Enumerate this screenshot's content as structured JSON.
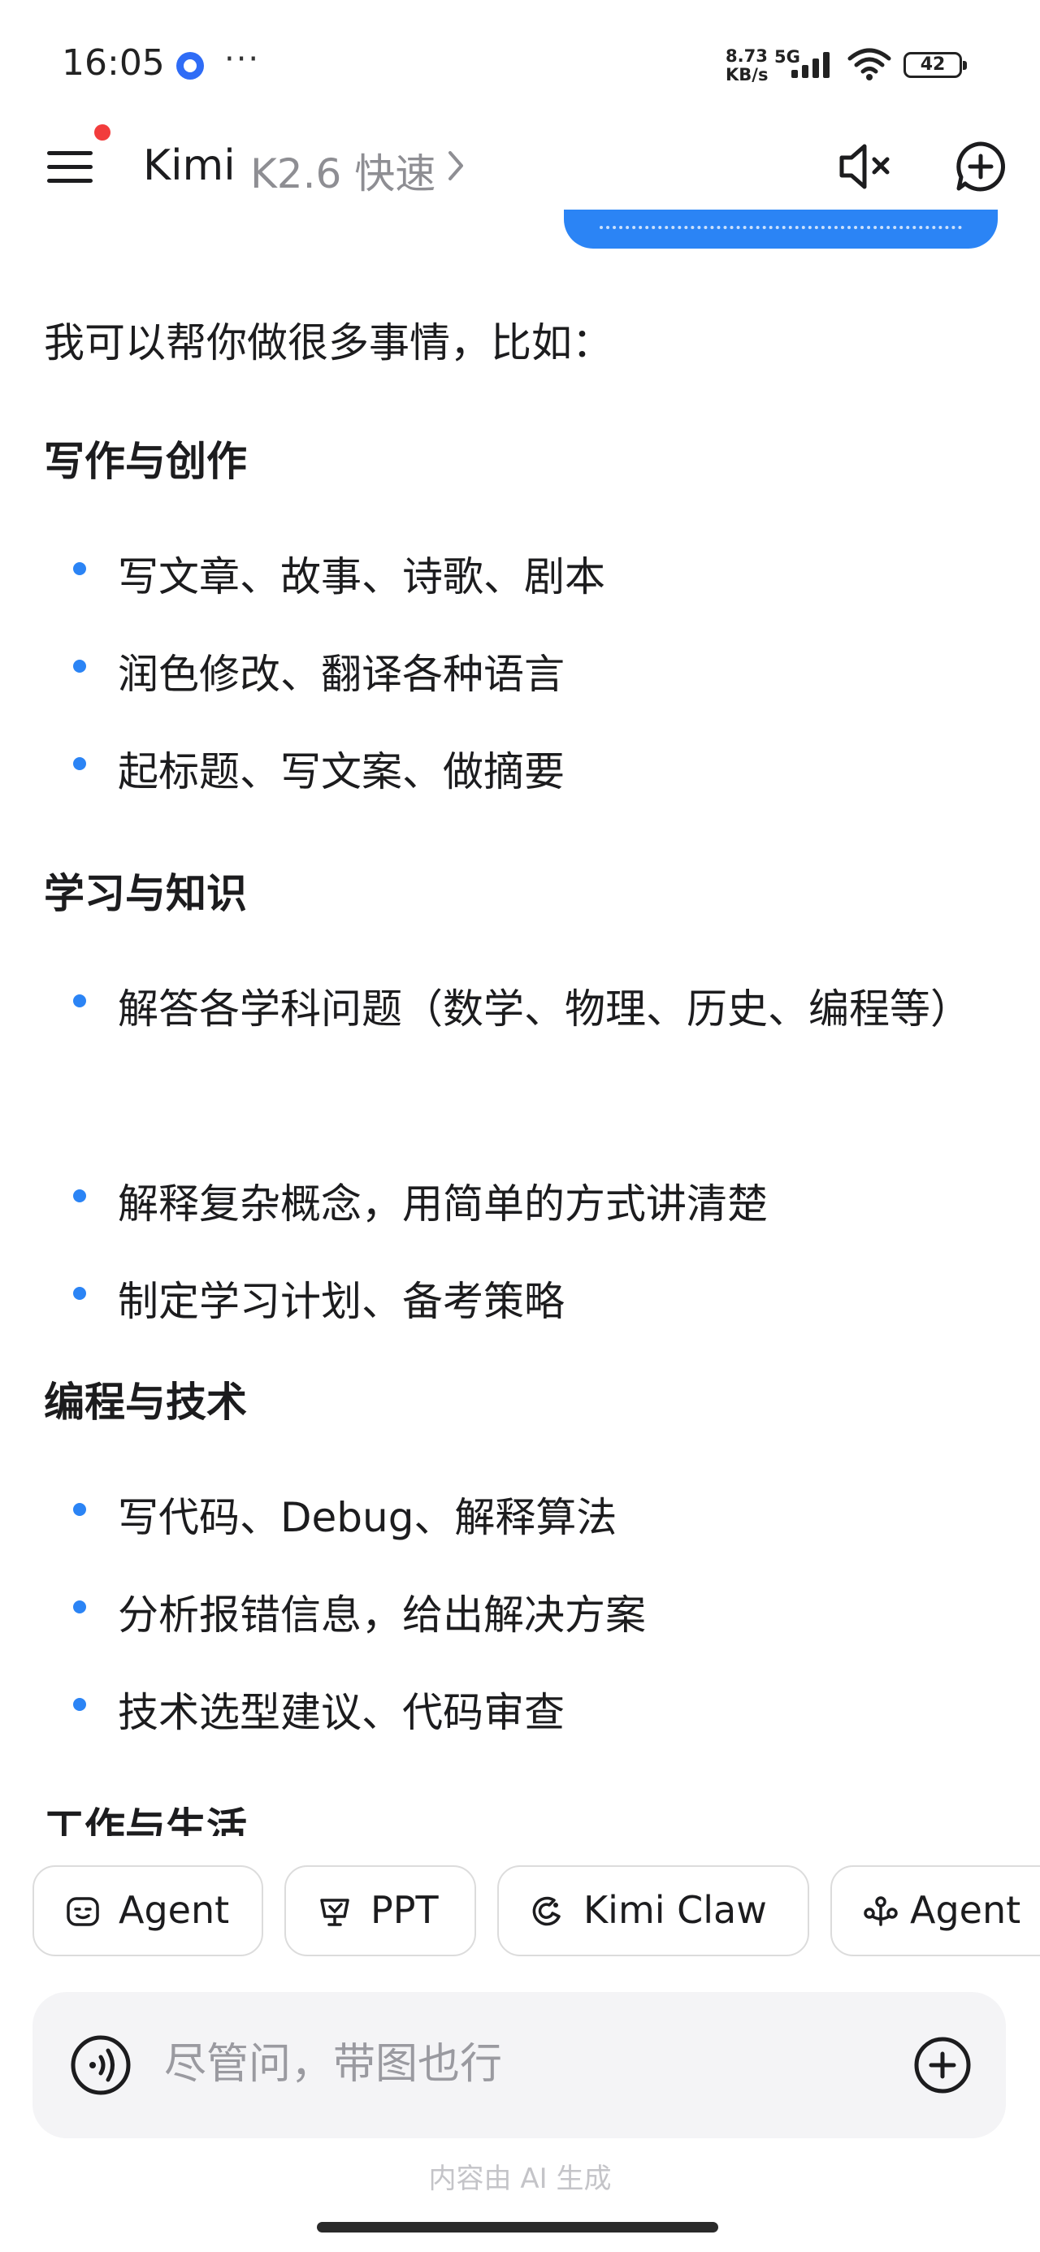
{
  "status_bar": {
    "time": "16:05",
    "net_speed_value": "8.73",
    "net_speed_unit": "KB/s",
    "network_type": "5G",
    "battery": "42"
  },
  "header": {
    "title": "Kimi",
    "model": "K2.6 快速"
  },
  "message": {
    "intro": "我可以帮你做很多事情，比如：",
    "sections": [
      {
        "title": "写作与创作",
        "items": [
          "写文章、故事、诗歌、剧本",
          "润色修改、翻译各种语言",
          "起标题、写文案、做摘要"
        ]
      },
      {
        "title": "学习与知识",
        "items": [
          "解答各学科问题（数学、物理、历史、编程等）",
          "解释复杂概念，用简单的方式讲清楚",
          "制定学习计划、备考策略"
        ]
      },
      {
        "title": "编程与技术",
        "items": [
          "写代码、Debug、解释算法",
          "分析报错信息，给出解决方案",
          "技术选型建议、代码审查"
        ]
      },
      {
        "title": "工作与生活",
        "items": []
      }
    ]
  },
  "chips": [
    {
      "label": "Agent",
      "icon": "agent-robot-icon"
    },
    {
      "label": "PPT",
      "icon": "ppt-presentation-icon"
    },
    {
      "label": "Kimi Claw",
      "icon": "claw-icon"
    },
    {
      "label": "Agent",
      "icon": "agent-cluster-icon"
    }
  ],
  "input": {
    "placeholder": "尽管问，带图也行"
  },
  "footer": {
    "note": "内容由 AI 生成"
  },
  "colors": {
    "accent": "#2b84f5",
    "badge": "#f23c3c"
  }
}
